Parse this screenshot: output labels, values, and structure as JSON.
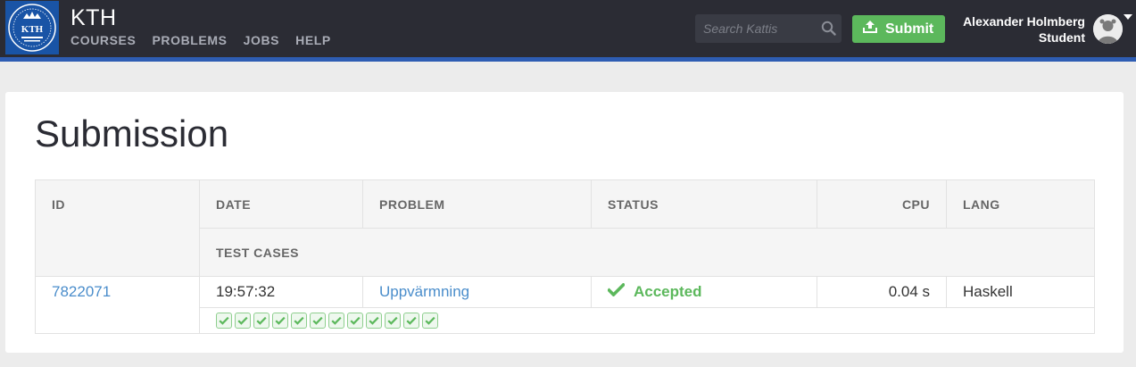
{
  "header": {
    "brand": "KTH",
    "logo_text": "KTH",
    "nav": [
      {
        "label": "COURSES"
      },
      {
        "label": "PROBLEMS"
      },
      {
        "label": "JOBS"
      },
      {
        "label": "HELP"
      }
    ],
    "search_placeholder": "Search Kattis",
    "submit_label": "Submit",
    "user_name": "Alexander Holmberg",
    "user_role": "Student"
  },
  "page": {
    "title": "Submission"
  },
  "table": {
    "headers": {
      "id": "ID",
      "date": "DATE",
      "problem": "PROBLEM",
      "status": "STATUS",
      "cpu": "CPU",
      "lang": "LANG",
      "test_cases": "TEST CASES"
    },
    "row": {
      "id": "7822071",
      "date": "19:57:32",
      "problem": "Uppvärmning",
      "status": "Accepted",
      "cpu": "0.04 s",
      "lang": "Haskell",
      "test_cases_passed": 12,
      "test_cases_total": 12
    }
  },
  "colors": {
    "accent": "#2e5db3",
    "success": "#5cb85c",
    "link": "#4a8dcb"
  }
}
